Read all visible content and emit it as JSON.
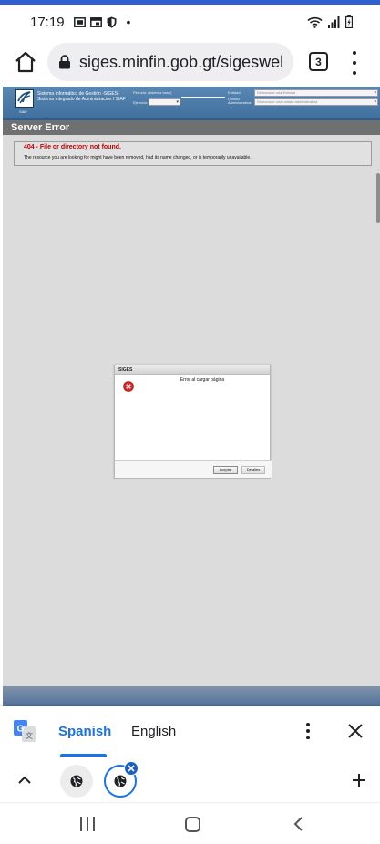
{
  "status_bar": {
    "time": "17:19",
    "dot": "•",
    "icons_left": [
      "gallery-icon",
      "calendar-icon",
      "shield-icon"
    ],
    "icons_right": [
      "wifi-icon",
      "signal-icon",
      "battery-icon"
    ]
  },
  "browser": {
    "url": "siges.minfin.gob.gt/sigeswel",
    "tab_count": "3"
  },
  "siges_header": {
    "title_line1": "Sistema Informático de Gestión -SIGES-",
    "title_line2": "Sistema Integrado de Administración / SIAF",
    "logo_caption": "SIAF",
    "field_periodo": "Período: (sistema base)",
    "field_ejercicio": "Ejercicio:",
    "field_entidad": "Entidad:",
    "field_unidad": "Unidad Administrativa:",
    "select_entidad": "Seleccione una Entidad",
    "select_unidad": "Seleccione una unidad administrativa"
  },
  "page": {
    "error_bar": "Server Error",
    "error_title": "404 - File or directory not found.",
    "error_message": "The resource you are looking for might have been removed, had its name changed, or is temporarily unavailable."
  },
  "dialog": {
    "title": "SIGES",
    "message": "Error al cargar página",
    "accept_label": "Aceptar",
    "details_label": "Detalles"
  },
  "translate": {
    "source_lang": "Spanish",
    "target_lang": "English"
  },
  "colors": {
    "accent": "#1a73e8",
    "error_red": "#c00000",
    "header_blue": "#4a78a6"
  }
}
